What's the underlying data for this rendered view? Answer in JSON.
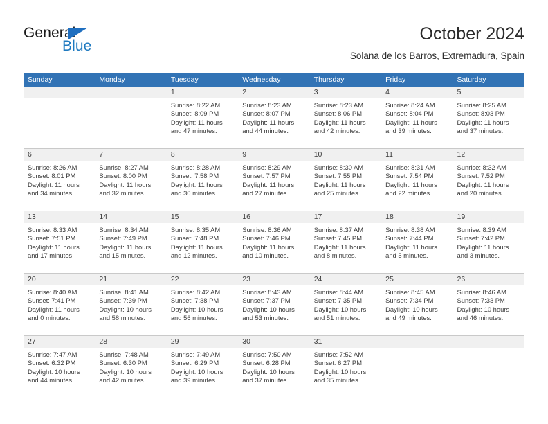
{
  "brand": {
    "word_general": "General",
    "word_blue": "Blue"
  },
  "header": {
    "title": "October 2024",
    "subtitle": "Solana de los Barros, Extremadura, Spain"
  },
  "weekdays": [
    "Sunday",
    "Monday",
    "Tuesday",
    "Wednesday",
    "Thursday",
    "Friday",
    "Saturday"
  ],
  "colors": {
    "header_blue": "#3273b5",
    "date_band": "#f0f0f0",
    "grid_line": "#c9c9c9",
    "text": "#3b3b3b",
    "brand_blue": "#1f7ac0"
  },
  "weeks": [
    [
      {
        "day": "",
        "empty": true
      },
      {
        "day": "",
        "empty": true
      },
      {
        "day": "1",
        "sunrise": "Sunrise: 8:22 AM",
        "sunset": "Sunset: 8:09 PM",
        "daylight": "Daylight: 11 hours and 47 minutes."
      },
      {
        "day": "2",
        "sunrise": "Sunrise: 8:23 AM",
        "sunset": "Sunset: 8:07 PM",
        "daylight": "Daylight: 11 hours and 44 minutes."
      },
      {
        "day": "3",
        "sunrise": "Sunrise: 8:23 AM",
        "sunset": "Sunset: 8:06 PM",
        "daylight": "Daylight: 11 hours and 42 minutes."
      },
      {
        "day": "4",
        "sunrise": "Sunrise: 8:24 AM",
        "sunset": "Sunset: 8:04 PM",
        "daylight": "Daylight: 11 hours and 39 minutes."
      },
      {
        "day": "5",
        "sunrise": "Sunrise: 8:25 AM",
        "sunset": "Sunset: 8:03 PM",
        "daylight": "Daylight: 11 hours and 37 minutes."
      }
    ],
    [
      {
        "day": "6",
        "sunrise": "Sunrise: 8:26 AM",
        "sunset": "Sunset: 8:01 PM",
        "daylight": "Daylight: 11 hours and 34 minutes."
      },
      {
        "day": "7",
        "sunrise": "Sunrise: 8:27 AM",
        "sunset": "Sunset: 8:00 PM",
        "daylight": "Daylight: 11 hours and 32 minutes."
      },
      {
        "day": "8",
        "sunrise": "Sunrise: 8:28 AM",
        "sunset": "Sunset: 7:58 PM",
        "daylight": "Daylight: 11 hours and 30 minutes."
      },
      {
        "day": "9",
        "sunrise": "Sunrise: 8:29 AM",
        "sunset": "Sunset: 7:57 PM",
        "daylight": "Daylight: 11 hours and 27 minutes."
      },
      {
        "day": "10",
        "sunrise": "Sunrise: 8:30 AM",
        "sunset": "Sunset: 7:55 PM",
        "daylight": "Daylight: 11 hours and 25 minutes."
      },
      {
        "day": "11",
        "sunrise": "Sunrise: 8:31 AM",
        "sunset": "Sunset: 7:54 PM",
        "daylight": "Daylight: 11 hours and 22 minutes."
      },
      {
        "day": "12",
        "sunrise": "Sunrise: 8:32 AM",
        "sunset": "Sunset: 7:52 PM",
        "daylight": "Daylight: 11 hours and 20 minutes."
      }
    ],
    [
      {
        "day": "13",
        "sunrise": "Sunrise: 8:33 AM",
        "sunset": "Sunset: 7:51 PM",
        "daylight": "Daylight: 11 hours and 17 minutes."
      },
      {
        "day": "14",
        "sunrise": "Sunrise: 8:34 AM",
        "sunset": "Sunset: 7:49 PM",
        "daylight": "Daylight: 11 hours and 15 minutes."
      },
      {
        "day": "15",
        "sunrise": "Sunrise: 8:35 AM",
        "sunset": "Sunset: 7:48 PM",
        "daylight": "Daylight: 11 hours and 12 minutes."
      },
      {
        "day": "16",
        "sunrise": "Sunrise: 8:36 AM",
        "sunset": "Sunset: 7:46 PM",
        "daylight": "Daylight: 11 hours and 10 minutes."
      },
      {
        "day": "17",
        "sunrise": "Sunrise: 8:37 AM",
        "sunset": "Sunset: 7:45 PM",
        "daylight": "Daylight: 11 hours and 8 minutes."
      },
      {
        "day": "18",
        "sunrise": "Sunrise: 8:38 AM",
        "sunset": "Sunset: 7:44 PM",
        "daylight": "Daylight: 11 hours and 5 minutes."
      },
      {
        "day": "19",
        "sunrise": "Sunrise: 8:39 AM",
        "sunset": "Sunset: 7:42 PM",
        "daylight": "Daylight: 11 hours and 3 minutes."
      }
    ],
    [
      {
        "day": "20",
        "sunrise": "Sunrise: 8:40 AM",
        "sunset": "Sunset: 7:41 PM",
        "daylight": "Daylight: 11 hours and 0 minutes."
      },
      {
        "day": "21",
        "sunrise": "Sunrise: 8:41 AM",
        "sunset": "Sunset: 7:39 PM",
        "daylight": "Daylight: 10 hours and 58 minutes."
      },
      {
        "day": "22",
        "sunrise": "Sunrise: 8:42 AM",
        "sunset": "Sunset: 7:38 PM",
        "daylight": "Daylight: 10 hours and 56 minutes."
      },
      {
        "day": "23",
        "sunrise": "Sunrise: 8:43 AM",
        "sunset": "Sunset: 7:37 PM",
        "daylight": "Daylight: 10 hours and 53 minutes."
      },
      {
        "day": "24",
        "sunrise": "Sunrise: 8:44 AM",
        "sunset": "Sunset: 7:35 PM",
        "daylight": "Daylight: 10 hours and 51 minutes."
      },
      {
        "day": "25",
        "sunrise": "Sunrise: 8:45 AM",
        "sunset": "Sunset: 7:34 PM",
        "daylight": "Daylight: 10 hours and 49 minutes."
      },
      {
        "day": "26",
        "sunrise": "Sunrise: 8:46 AM",
        "sunset": "Sunset: 7:33 PM",
        "daylight": "Daylight: 10 hours and 46 minutes."
      }
    ],
    [
      {
        "day": "27",
        "sunrise": "Sunrise: 7:47 AM",
        "sunset": "Sunset: 6:32 PM",
        "daylight": "Daylight: 10 hours and 44 minutes."
      },
      {
        "day": "28",
        "sunrise": "Sunrise: 7:48 AM",
        "sunset": "Sunset: 6:30 PM",
        "daylight": "Daylight: 10 hours and 42 minutes."
      },
      {
        "day": "29",
        "sunrise": "Sunrise: 7:49 AM",
        "sunset": "Sunset: 6:29 PM",
        "daylight": "Daylight: 10 hours and 39 minutes."
      },
      {
        "day": "30",
        "sunrise": "Sunrise: 7:50 AM",
        "sunset": "Sunset: 6:28 PM",
        "daylight": "Daylight: 10 hours and 37 minutes."
      },
      {
        "day": "31",
        "sunrise": "Sunrise: 7:52 AM",
        "sunset": "Sunset: 6:27 PM",
        "daylight": "Daylight: 10 hours and 35 minutes."
      },
      {
        "day": "",
        "empty": true
      },
      {
        "day": "",
        "empty": true
      }
    ]
  ]
}
